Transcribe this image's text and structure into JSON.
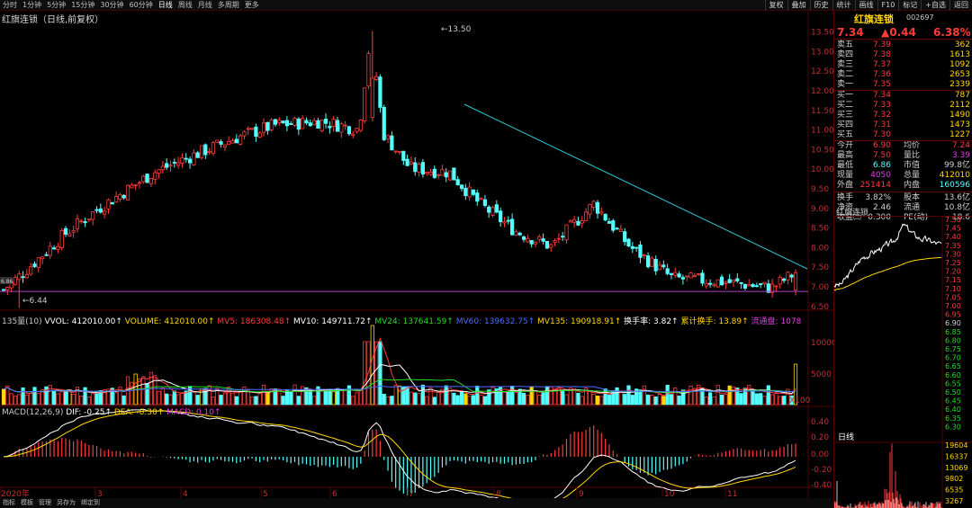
{
  "toolbar": {
    "periods": [
      "分时",
      "1分钟",
      "5分钟",
      "15分钟",
      "30分钟",
      "60分钟",
      "日线",
      "周线",
      "月线",
      "多周期",
      "更多"
    ],
    "active": "日线",
    "right": [
      "复权",
      "叠加",
      "历史",
      "统计",
      "画线",
      "F10",
      "标记",
      "+自选",
      "返回"
    ]
  },
  "title": "红旗连锁（日线,前复权）",
  "price_axis": {
    "labels": [
      "13.50",
      "13.00",
      "12.50",
      "12.00",
      "11.50",
      "11.00",
      "10.50",
      "10.00",
      "9.50",
      "9.00",
      "8.50",
      "8.00",
      "7.50",
      "7.00",
      "6.50"
    ]
  },
  "annotations": {
    "high": "13.50",
    "low": "6.44",
    "left_price": "6.86"
  },
  "volume": {
    "header": [
      "135量(10)",
      "VVOL: 412010.00↑",
      "VOLUME: 412010.00↑",
      "MV5: 186308.48↑",
      "MV10: 149711.72↑",
      "MV24: 137641.59↑",
      "MV60: 139632.75↑",
      "MV135: 190918.91↑",
      "换手率: 3.82↑",
      "累计换手: 13.89↑",
      "流通盘: 1078"
    ],
    "header_colors": [
      "#c8c8c8",
      "#ffffff",
      "#ffd700",
      "#ff3b3b",
      "#ffffff",
      "#22dd22",
      "#4b6bff",
      "#ffd700",
      "#ffffff",
      "#ffd700",
      "#e040e0"
    ],
    "axis": [
      "10000",
      "5000",
      "X100"
    ]
  },
  "macd": {
    "header": [
      "MACD(12,26,9)",
      "DIF: -0.25↑",
      "DEA: -0.30↑",
      "MACD: 0.10↑"
    ],
    "header_colors": [
      "#c8c8c8",
      "#ffffff",
      "#ffd700",
      "#e040e0"
    ],
    "axis": [
      "0.40",
      "0.20",
      "0.00",
      "-0.20",
      "-0.40"
    ]
  },
  "time_axis": [
    "2020年",
    "3",
    "4",
    "5",
    "6",
    "7",
    "8",
    "9",
    "10",
    "11"
  ],
  "bottom_tabs": [
    "指标",
    "模板",
    "管理",
    "另存为",
    "绑定到"
  ],
  "quote": {
    "name": "红旗连锁",
    "code": "002697",
    "price": "7.34",
    "change": "▲0.44",
    "pct": "6.38%",
    "sells": [
      [
        "卖五",
        "7.39",
        "362"
      ],
      [
        "卖四",
        "7.38",
        "1613"
      ],
      [
        "卖三",
        "7.37",
        "1092"
      ],
      [
        "卖二",
        "7.36",
        "2653"
      ],
      [
        "卖一",
        "7.35",
        "2339"
      ]
    ],
    "buys": [
      [
        "买一",
        "7.34",
        "787"
      ],
      [
        "买二",
        "7.33",
        "2112"
      ],
      [
        "买三",
        "7.32",
        "1490"
      ],
      [
        "买四",
        "7.31",
        "1473"
      ],
      [
        "买五",
        "7.30",
        "1227"
      ]
    ],
    "stats": [
      [
        "今开",
        "6.90",
        "均价",
        "7.24"
      ],
      [
        "最高",
        "7.50",
        "量比",
        "3.39"
      ],
      [
        "最低",
        "6.86",
        "市值",
        "99.8亿"
      ],
      [
        "现量",
        "4050",
        "总量",
        "412010"
      ],
      [
        "外盘",
        "251414",
        "内盘",
        "160596"
      ],
      [
        "换手",
        "3.82%",
        "股本",
        "13.6亿"
      ],
      [
        "净资",
        "2.46",
        "流通",
        "10.8亿"
      ],
      [
        "收益㈢",
        "0.300",
        "PE(动)",
        "18.6"
      ]
    ],
    "mini_title": "红旗连锁",
    "mini_axis": [
      "7.50",
      "7.45",
      "7.40",
      "7.35",
      "7.30",
      "7.25",
      "7.20",
      "7.15",
      "7.10",
      "7.05",
      "7.00",
      "6.95",
      "6.90",
      "6.85",
      "6.80",
      "6.75",
      "6.70",
      "6.65",
      "6.60",
      "6.55",
      "6.50",
      "6.45",
      "6.40",
      "6.35",
      "6.30"
    ],
    "mini_vol_axis": [
      "19604",
      "16337",
      "13069",
      "9802",
      "6535",
      "3267"
    ],
    "mini_tab": "日线"
  },
  "chart_data": {
    "type": "candlestick",
    "price_range": [
      6.44,
      13.5
    ],
    "x_labels": [
      "3",
      "4",
      "5",
      "6",
      "7",
      "8",
      "9",
      "10",
      "11"
    ],
    "last_close": 7.34
  }
}
